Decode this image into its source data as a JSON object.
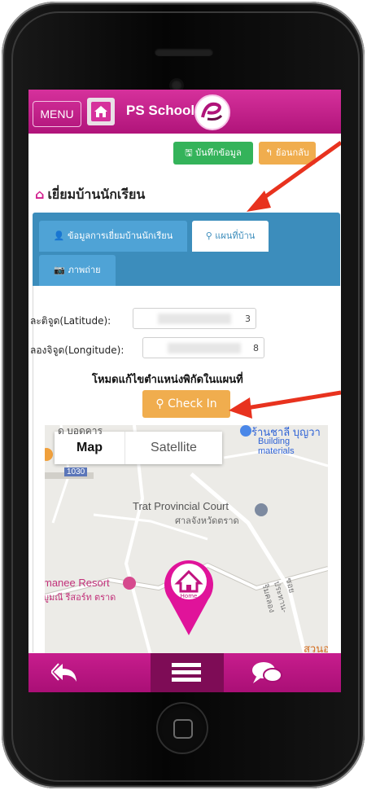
{
  "app": {
    "menu_label": "MENU",
    "brand": "PS School"
  },
  "toolbar": {
    "save_label": "บันทึกข้อมูล",
    "back_label": "ย้อนกลับ"
  },
  "page": {
    "title": "เยี่ยมบ้านนักเรียน"
  },
  "tabs": [
    {
      "label": "ข้อมูลการเยี่ยมบ้านนักเรียน",
      "active": false
    },
    {
      "label": "แผนที่บ้าน",
      "active": true
    },
    {
      "label": "ภาพถ่าย",
      "active": false
    }
  ],
  "form": {
    "latitude_label": "ละติจูด(Latitude):",
    "latitude_tail": "3",
    "longitude_label": "ลองจิจูด(Longitude):",
    "longitude_tail": "8",
    "mode_text": "โหมดแก้ไขตำแหน่งพิกัดในแผนที่",
    "checkin_label": "Check In"
  },
  "map": {
    "type_map": "Map",
    "type_satellite": "Satellite",
    "labels": {
      "top_left": "ด บอดคาร",
      "shop": "ร้านชาลี บุญวา",
      "shop_sub": "Building materials",
      "road_num": "1030",
      "court": "Trat Provincial Court",
      "court_th": "ศาลจังหวัดตราด",
      "resort": "manee Resort",
      "resort_th": "บูมณี รีสอร์ท ตราด",
      "road_th": "ซอยประทาน-ริมคลอง",
      "bottom_right": "สวนอ",
      "marker": "Home"
    }
  },
  "colors": {
    "brand": "#c71d8d",
    "tab_bar": "#3c8dbc",
    "save": "#34b35a",
    "warn": "#f0ad4e",
    "annotation": "#e8321e"
  }
}
